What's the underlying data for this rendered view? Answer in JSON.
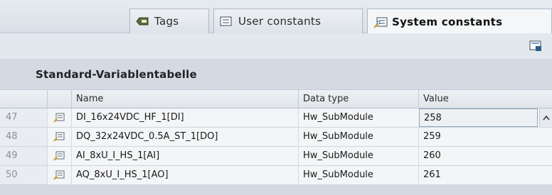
{
  "tabs": [
    {
      "label": "Tags",
      "icon": "tags-icon",
      "active": false
    },
    {
      "label": "User constants",
      "icon": "list-icon",
      "active": false
    },
    {
      "label": "System constants",
      "icon": "system-constants-icon",
      "active": true
    }
  ],
  "toolbar": {
    "icon": "monitor-icon"
  },
  "table": {
    "title": "Standard-Variablentabelle",
    "columns": [
      "Name",
      "Data type",
      "Value"
    ],
    "rows": [
      {
        "num": "47",
        "name": "DI_16x24VDC_HF_1[DI]",
        "dtype": "Hw_SubModule",
        "value": "258"
      },
      {
        "num": "48",
        "name": "DQ_32x24VDC_0.5A_ST_1[DO]",
        "dtype": "Hw_SubModule",
        "value": "259"
      },
      {
        "num": "49",
        "name": "AI_8xU_I_HS_1[AI]",
        "dtype": "Hw_SubModule",
        "value": "260"
      },
      {
        "num": "50",
        "name": "AQ_8xU_I_HS_1[AO]",
        "dtype": "Hw_SubModule",
        "value": "261"
      }
    ]
  }
}
